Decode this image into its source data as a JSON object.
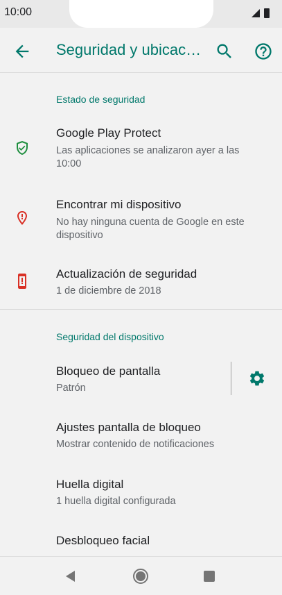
{
  "status_bar": {
    "time": "10:00"
  },
  "app_bar": {
    "title": "Seguridad y ubicac…"
  },
  "sections": {
    "security_status": {
      "header": "Estado de seguridad",
      "items": [
        {
          "title": "Google Play Protect",
          "subtitle": "Las aplicaciones se analizaron ayer a las 10:00",
          "icon": "shield-check-icon",
          "icon_color": "#1e8e3e"
        },
        {
          "title": "Encontrar mi dispositivo",
          "subtitle": "No hay ninguna cuenta de Google en este dispositivo",
          "icon": "location-alert-icon",
          "icon_color": "#d93025"
        },
        {
          "title": "Actualización de seguridad",
          "subtitle": "1 de diciembre de 2018",
          "icon": "phone-alert-icon",
          "icon_color": "#d93025"
        }
      ]
    },
    "device_security": {
      "header": "Seguridad del dispositivo",
      "items": [
        {
          "title": "Bloqueo de pantalla",
          "subtitle": "Patrón",
          "icon": "gear-icon"
        },
        {
          "title": "Ajustes pantalla de bloqueo",
          "subtitle": "Mostrar contenido de notificaciones"
        },
        {
          "title": "Huella digital",
          "subtitle": "1 huella digital configurada"
        },
        {
          "title": "Desbloqueo facial",
          "subtitle": ""
        }
      ]
    }
  },
  "colors": {
    "accent": "#00786b",
    "background": "#f2f2f2"
  }
}
